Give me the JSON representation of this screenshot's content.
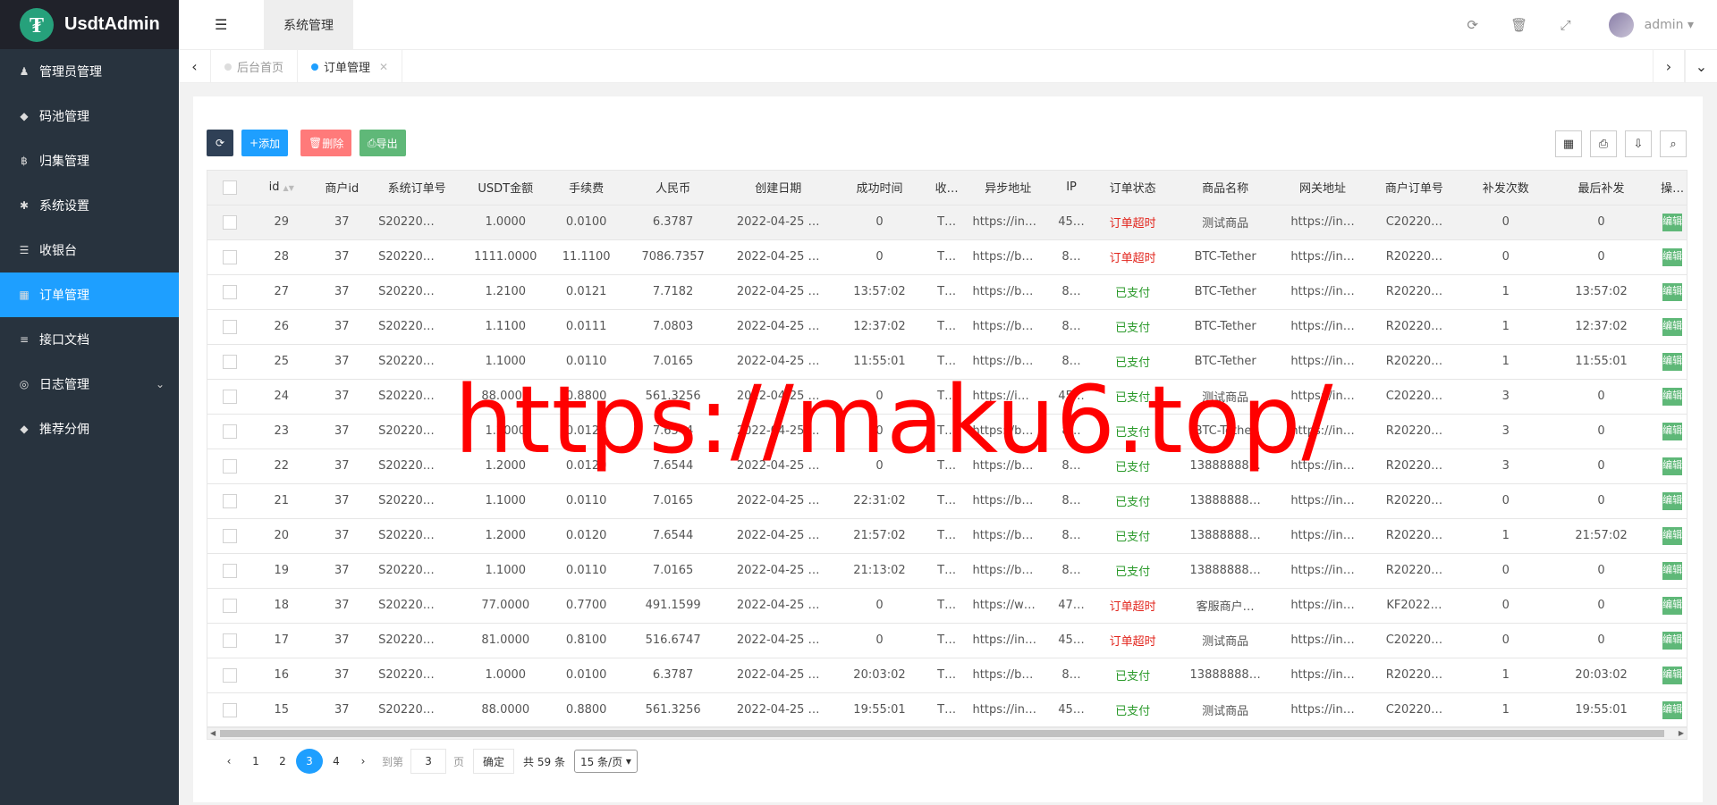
{
  "app": {
    "logo_letter": "₮",
    "title": "UsdtAdmin"
  },
  "sidebar": {
    "items": [
      {
        "icon": "user-icon",
        "glyph": "♟",
        "label": "管理员管理"
      },
      {
        "icon": "android-icon",
        "glyph": "◆",
        "label": "码池管理"
      },
      {
        "icon": "bitcoin-icon",
        "glyph": "฿",
        "label": "归集管理"
      },
      {
        "icon": "gear-icon",
        "glyph": "✱",
        "label": "系统设置"
      },
      {
        "icon": "list-icon",
        "glyph": "☰",
        "label": "收银台"
      },
      {
        "icon": "calculator-icon",
        "glyph": "▦",
        "label": "订单管理"
      },
      {
        "icon": "document-icon",
        "glyph": "≡",
        "label": "接口文档"
      },
      {
        "icon": "log-icon",
        "glyph": "◎",
        "label": "日志管理"
      },
      {
        "icon": "android-icon",
        "glyph": "◆",
        "label": "推荐分佣"
      }
    ]
  },
  "header": {
    "topnav": "系统管理",
    "user": "admin"
  },
  "tabs": [
    {
      "label": "后台首页"
    },
    {
      "label": "订单管理"
    }
  ],
  "toolbar": {
    "add": "添加",
    "delete": "删除",
    "export": "导出"
  },
  "table": {
    "columns": [
      "id",
      "商户id",
      "系统订单号",
      "USDT金额",
      "手续费",
      "人民币",
      "创建日期",
      "成功时间",
      "收…",
      "异步地址",
      "IP",
      "订单状态",
      "商品名称",
      "网关地址",
      "商户订单号",
      "补发次数",
      "最后补发",
      "操…"
    ],
    "rows": [
      [
        "29",
        "37",
        "S20220…",
        "1.0000",
        "0.0100",
        "6.3787",
        "2022-04-25 …",
        "0",
        "T…",
        "https://in…",
        "45…",
        "订单超时",
        "测试商品",
        "https://in…",
        "C20220…",
        "0",
        "0"
      ],
      [
        "28",
        "37",
        "S20220…",
        "1111.0000",
        "11.1100",
        "7086.7357",
        "2022-04-25 …",
        "0",
        "T…",
        "https://b…",
        "8…",
        "订单超时",
        "BTC-Tether",
        "https://in…",
        "R20220…",
        "0",
        "0"
      ],
      [
        "27",
        "37",
        "S20220…",
        "1.2100",
        "0.0121",
        "7.7182",
        "2022-04-25 …",
        "13:57:02",
        "T…",
        "https://b…",
        "8…",
        "已支付",
        "BTC-Tether",
        "https://in…",
        "R20220…",
        "1",
        "13:57:02"
      ],
      [
        "26",
        "37",
        "S20220…",
        "1.1100",
        "0.0111",
        "7.0803",
        "2022-04-25 …",
        "12:37:02",
        "T…",
        "https://b…",
        "8…",
        "已支付",
        "BTC-Tether",
        "https://in…",
        "R20220…",
        "1",
        "12:37:02"
      ],
      [
        "25",
        "37",
        "S20220…",
        "1.1000",
        "0.0110",
        "7.0165",
        "2022-04-25 …",
        "11:55:01",
        "T…",
        "https://b…",
        "8…",
        "已支付",
        "BTC-Tether",
        "https://in…",
        "R20220…",
        "1",
        "11:55:01"
      ],
      [
        "24",
        "37",
        "S20220…",
        "88.0000",
        "0.8800",
        "561.3256",
        "2022-04-25 …",
        "0",
        "T…",
        "https://i…",
        "45…",
        "已支付",
        "测试商品",
        "https://in…",
        "C20220…",
        "3",
        "0"
      ],
      [
        "23",
        "37",
        "S20220…",
        "1.2000",
        "0.0120",
        "7.6544",
        "2022-04-25 …",
        "0",
        "T…",
        "https://b…",
        "8…",
        "已支付",
        "BTC-Tether",
        "https://in…",
        "R20220…",
        "3",
        "0"
      ],
      [
        "22",
        "37",
        "S20220…",
        "1.2000",
        "0.0120",
        "7.6544",
        "2022-04-25 …",
        "0",
        "T…",
        "https://b…",
        "8…",
        "已支付",
        "13888888…",
        "https://in…",
        "R20220…",
        "3",
        "0"
      ],
      [
        "21",
        "37",
        "S20220…",
        "1.1000",
        "0.0110",
        "7.0165",
        "2022-04-25 …",
        "22:31:02",
        "T…",
        "https://b…",
        "8…",
        "已支付",
        "13888888…",
        "https://in…",
        "R20220…",
        "0",
        "0"
      ],
      [
        "20",
        "37",
        "S20220…",
        "1.2000",
        "0.0120",
        "7.6544",
        "2022-04-25 …",
        "21:57:02",
        "T…",
        "https://b…",
        "8…",
        "已支付",
        "13888888…",
        "https://in…",
        "R20220…",
        "1",
        "21:57:02"
      ],
      [
        "19",
        "37",
        "S20220…",
        "1.1000",
        "0.0110",
        "7.0165",
        "2022-04-25 …",
        "21:13:02",
        "T…",
        "https://b…",
        "8…",
        "已支付",
        "13888888…",
        "https://in…",
        "R20220…",
        "0",
        "0"
      ],
      [
        "18",
        "37",
        "S20220…",
        "77.0000",
        "0.7700",
        "491.1599",
        "2022-04-25 …",
        "0",
        "T…",
        "https://w…",
        "47…",
        "订单超时",
        "客服商户…",
        "https://in…",
        "KF2022…",
        "0",
        "0"
      ],
      [
        "17",
        "37",
        "S20220…",
        "81.0000",
        "0.8100",
        "516.6747",
        "2022-04-25 …",
        "0",
        "T…",
        "https://in…",
        "45…",
        "订单超时",
        "测试商品",
        "https://in…",
        "C20220…",
        "0",
        "0"
      ],
      [
        "16",
        "37",
        "S20220…",
        "1.0000",
        "0.0100",
        "6.3787",
        "2022-04-25 …",
        "20:03:02",
        "T…",
        "https://b…",
        "8…",
        "已支付",
        "13888888…",
        "https://in…",
        "R20220…",
        "1",
        "20:03:02"
      ],
      [
        "15",
        "37",
        "S20220…",
        "88.0000",
        "0.8800",
        "561.3256",
        "2022-04-25 …",
        "19:55:01",
        "T…",
        "https://in…",
        "45…",
        "已支付",
        "测试商品",
        "https://in…",
        "C20220…",
        "1",
        "19:55:01"
      ]
    ],
    "edit_label": "编辑"
  },
  "pager": {
    "pages": [
      "1",
      "2",
      "3",
      "4"
    ],
    "current": "3",
    "goto_label": "到第",
    "goto_value": "3",
    "page_unit": "页",
    "confirm": "确定",
    "total": "共 59 条",
    "per_page": "15 条/页"
  },
  "watermark": "https://maku6.top/",
  "colors": {
    "sidebar": "#28333e",
    "active": "#1e9fff",
    "add": "#1e9fff",
    "delete": "#ff5722",
    "export": "#5fb878",
    "timeout": "#e2261e",
    "paid": "#2b9a2b"
  }
}
